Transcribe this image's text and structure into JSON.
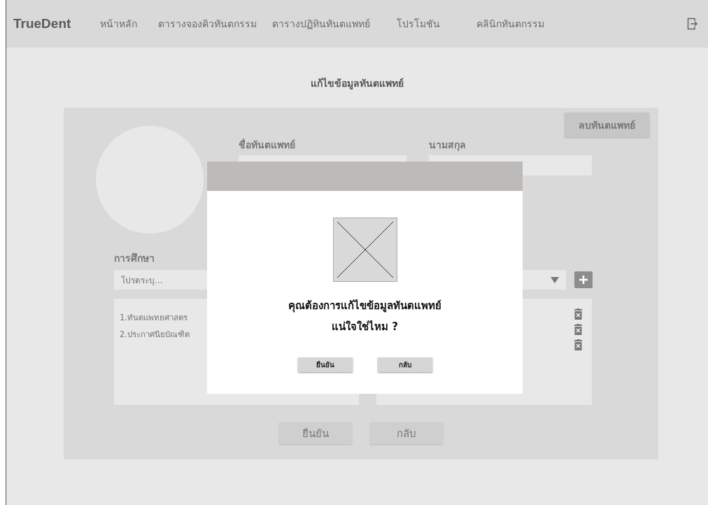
{
  "nav": {
    "brand": "TrueDent",
    "items": [
      {
        "label": "หน้าหลัก",
        "selected": false
      },
      {
        "label": "ตารางจองคิวทันตกรรม",
        "selected": false
      },
      {
        "label": "ตารางปฏิทินทันตแพทย์",
        "selected": false
      },
      {
        "label": "โปรโมชัน",
        "selected": false
      },
      {
        "label": "คลินิกทันตกรรม",
        "selected": false
      }
    ]
  },
  "page_title": "แก้ไขข้อมูลทันตแพทย์",
  "form": {
    "delete_button": "ลบทันตแพทย์",
    "first_name_label": "ชื่อทันตแพทย์",
    "last_name_label": "นามสกุล",
    "education_label": "การศึกษา",
    "education_select": {
      "placeholder": "โปรดระบุ..."
    },
    "education_items": [
      "1.ทันตแพทยศาสตร",
      "2.ประกาศนียบัณฑิต"
    ],
    "buttons": [
      "ยืนยัน",
      "กลับ"
    ]
  },
  "modal": {
    "message_lines": [
      "คุณต้องการแก้ไขข้อมูลทันตแพทย์",
      "แน่ใจใช่ไหม ?"
    ],
    "buttons": [
      "ยืนยัน",
      "กลับ"
    ]
  }
}
